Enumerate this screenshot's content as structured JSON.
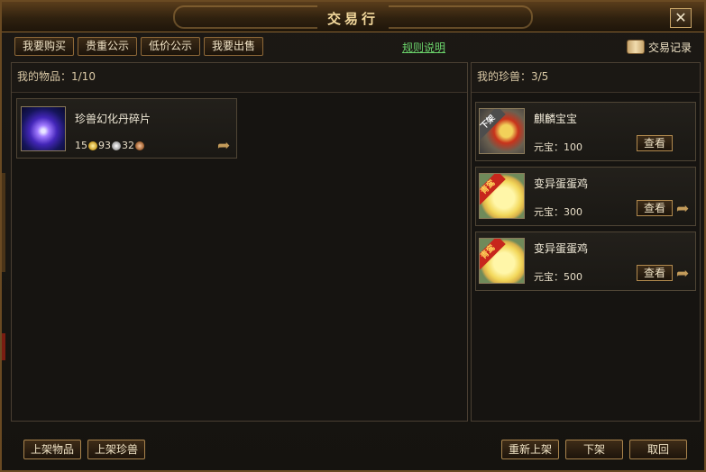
{
  "window": {
    "title": "交易行",
    "close_icon": "close-icon",
    "close_glyph": "✕"
  },
  "tabs": [
    {
      "label": "我要购买"
    },
    {
      "label": "贵重公示"
    },
    {
      "label": "低价公示"
    },
    {
      "label": "我要出售"
    }
  ],
  "rules_link": "规则说明",
  "trade_log": {
    "label": "交易记录",
    "icon": "scroll-icon"
  },
  "left_panel": {
    "header": "我的物品：1/10",
    "items": [
      {
        "name": "珍兽幻化丹碎片",
        "thumb_icon": "purple-orb-icon",
        "gold": "15",
        "silver": "93",
        "copper": "32",
        "share_icon": "share-arrow-icon"
      }
    ]
  },
  "right_panel": {
    "header": "我的珍兽：3/5",
    "pets": [
      {
        "ribbon": "下架",
        "name": "麒麟宝宝",
        "price": "元宝：100",
        "view_label": "查看",
        "thumb_icon": "qilin-icon"
      },
      {
        "ribbon": "青鸾",
        "name": "变异蛋蛋鸡",
        "price": "元宝：300",
        "view_label": "查看",
        "thumb_icon": "chick-icon",
        "share_icon": "share-arrow-icon"
      },
      {
        "ribbon": "青鸾",
        "name": "变异蛋蛋鸡",
        "price": "元宝：500",
        "view_label": "查看",
        "thumb_icon": "chick-icon",
        "share_icon": "share-arrow-icon"
      }
    ]
  },
  "footer": {
    "list_item": "上架物品",
    "list_pet": "上架珍兽",
    "relist": "重新上架",
    "delist": "下架",
    "cancel": "取回"
  },
  "colors": {
    "accent": "#f3d89c",
    "link": "#6bd36b",
    "border": "#a9844d"
  }
}
